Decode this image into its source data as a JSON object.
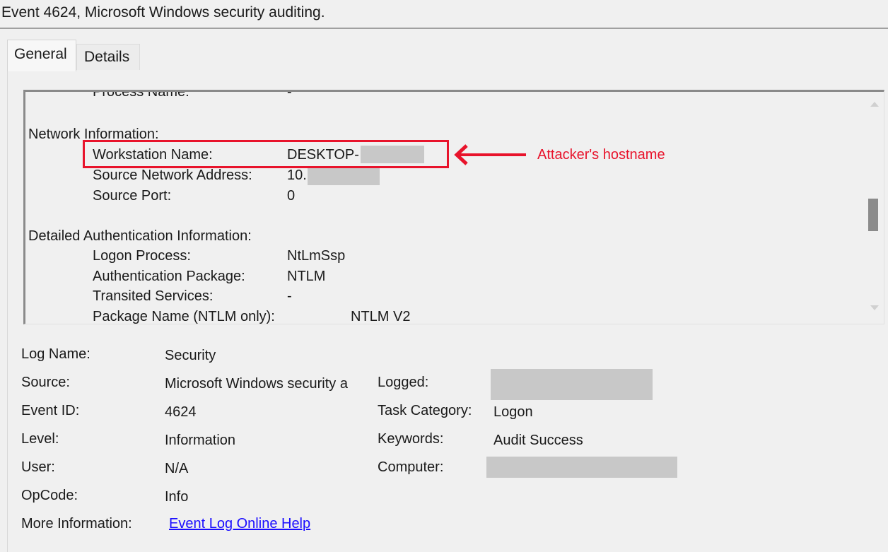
{
  "window": {
    "title": "Event 4624, Microsoft Windows security auditing."
  },
  "tabs": [
    {
      "label": "General"
    },
    {
      "label": "Details"
    }
  ],
  "description": {
    "partial_row": {
      "label": "Process Name:",
      "value": "-"
    },
    "network_header": "Network Information:",
    "network": [
      {
        "label": "Workstation Name:",
        "value": "DESKTOP-"
      },
      {
        "label": "Source Network Address:",
        "value": "10."
      },
      {
        "label": "Source Port:",
        "value": "0"
      }
    ],
    "auth_header": "Detailed Authentication Information:",
    "auth": [
      {
        "label": "Logon Process:",
        "value": "NtLmSsp"
      },
      {
        "label": "Authentication Package:",
        "value": "NTLM"
      },
      {
        "label": "Transited Services:",
        "value": "-"
      },
      {
        "label": "Package Name (NTLM only):",
        "value": "NTLM V2"
      }
    ]
  },
  "annotation": {
    "text": "Attacker's hostname",
    "color": "#e8132b"
  },
  "properties": {
    "log_name": {
      "label": "Log Name:",
      "value": "Security"
    },
    "source": {
      "label": "Source:",
      "value": "Microsoft Windows security a"
    },
    "event_id": {
      "label": "Event ID:",
      "value": "4624"
    },
    "level": {
      "label": "Level:",
      "value": "Information"
    },
    "user": {
      "label": "User:",
      "value": "N/A"
    },
    "opcode": {
      "label": "OpCode:",
      "value": "Info"
    },
    "more_info": {
      "label": "More Information:",
      "value": "Event Log Online Help"
    },
    "logged": {
      "label": "Logged:",
      "value": ""
    },
    "task_category": {
      "label": "Task Category:",
      "value": "Logon"
    },
    "keywords": {
      "label": "Keywords:",
      "value": "Audit Success"
    },
    "computer": {
      "label": "Computer:",
      "value": ""
    }
  },
  "colors": {
    "accent_red": "#e8132b",
    "link_blue": "#1a0dff",
    "redaction": "#c8c8c8"
  }
}
